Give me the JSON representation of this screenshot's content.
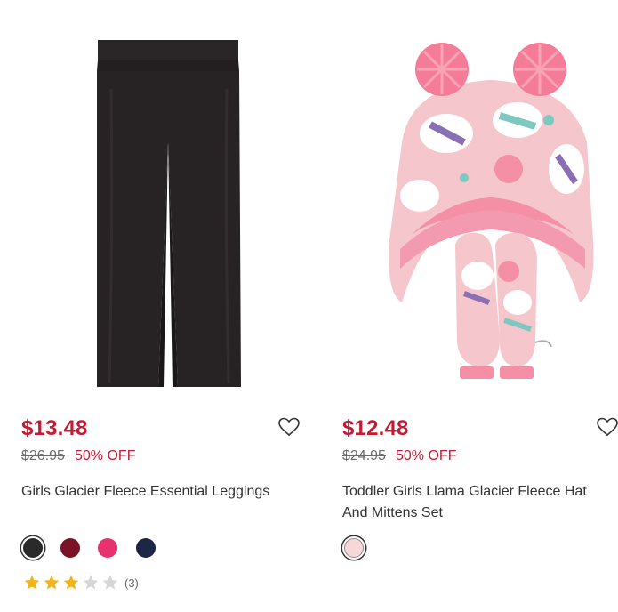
{
  "products": [
    {
      "name": "Girls Glacier Fleece Essential Leggings",
      "price": "$13.48",
      "original_price": "$26.95",
      "discount": "50% OFF",
      "swatch_colors": [
        "#2b2a2b",
        "#7a1228",
        "#e8326f",
        "#1b2744"
      ],
      "selected_swatch": 0,
      "rating": 3,
      "rating_max": 5,
      "review_count": "(3)",
      "image_icon": "leggings-image"
    },
    {
      "name_line1": "Toddler Girls Llama Glacier Fleece Hat",
      "name_line2": "And Mittens Set",
      "price": "$12.48",
      "original_price": "$24.95",
      "discount": "50% OFF",
      "swatch_colors": [
        "#f8d7d9"
      ],
      "image_icon": "hat-and-mittens-image"
    }
  ],
  "colors": {
    "price_red": "#c21b33",
    "star_filled": "#f2b418",
    "star_empty": "#d6d6d6"
  },
  "icons": {
    "wishlist": "heart-outline-icon",
    "rating": "star-icon"
  }
}
